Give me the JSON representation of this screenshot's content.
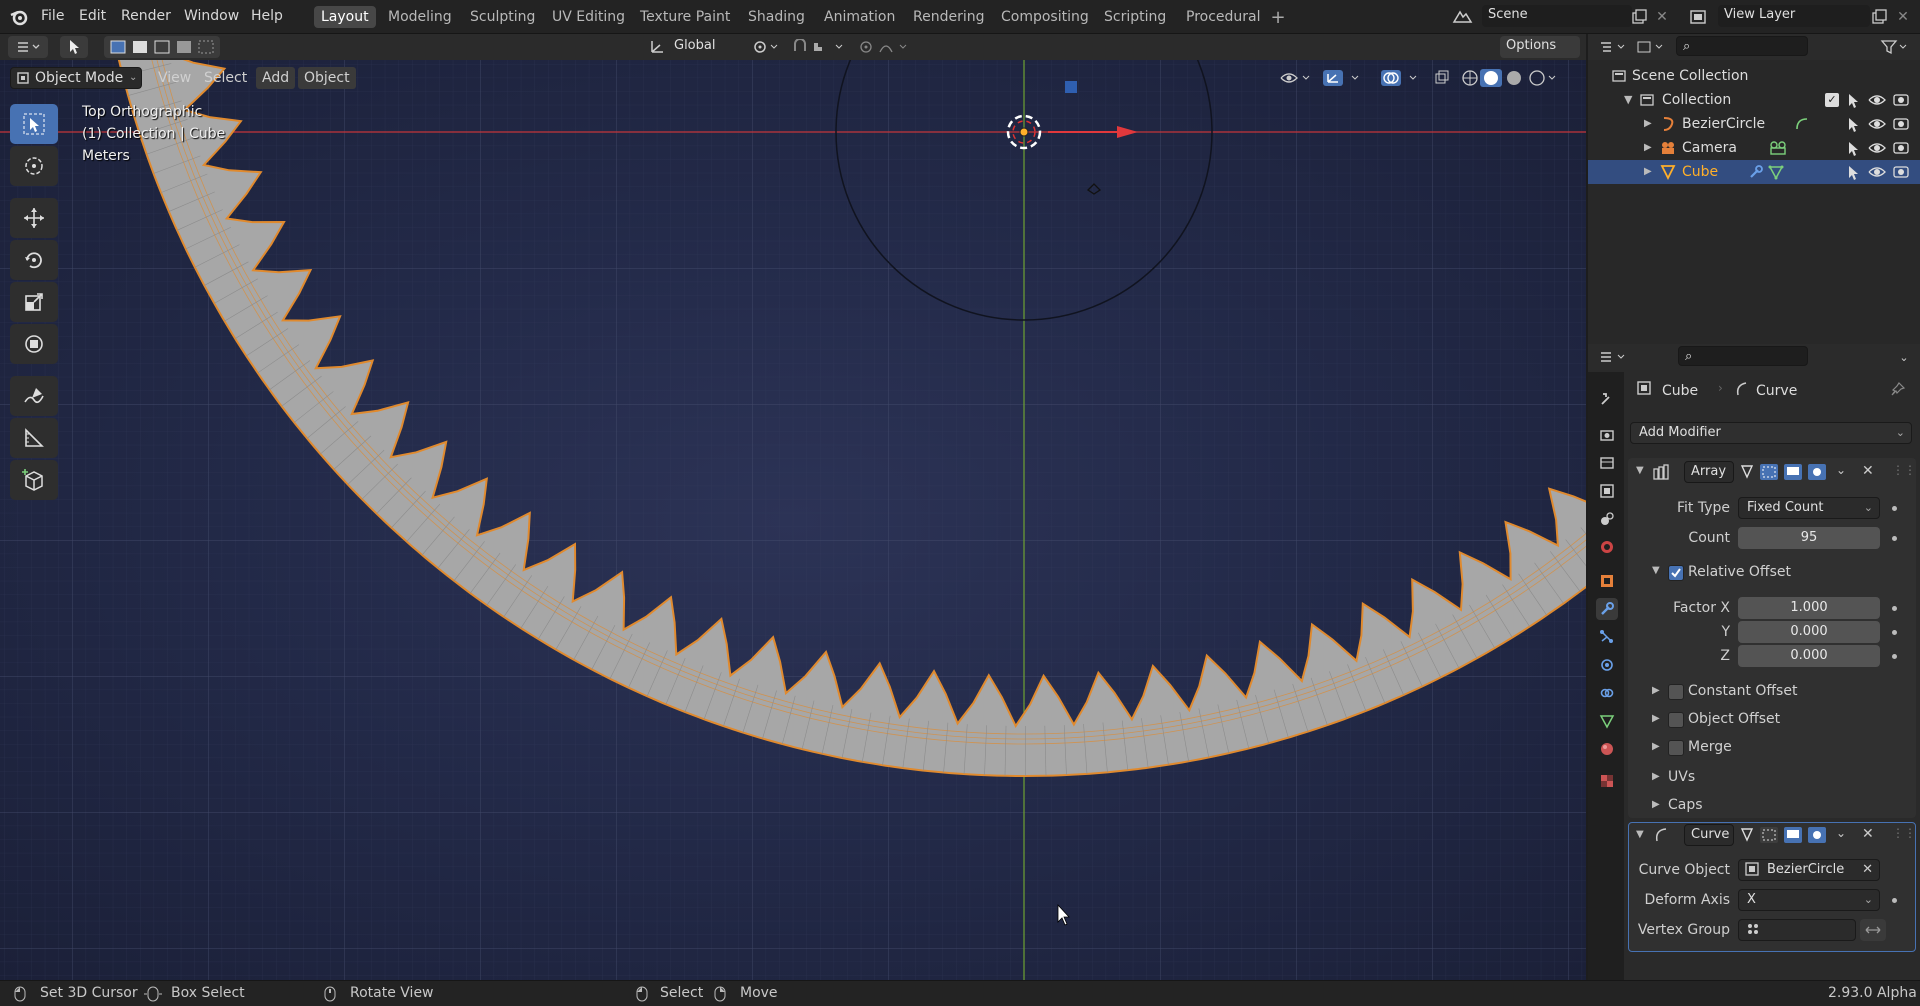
{
  "menu": {
    "file": "File",
    "edit": "Edit",
    "render": "Render",
    "window": "Window",
    "help": "Help"
  },
  "workspaces": [
    "Layout",
    "Modeling",
    "Sculpting",
    "UV Editing",
    "Texture Paint",
    "Shading",
    "Animation",
    "Rendering",
    "Compositing",
    "Scripting",
    "Procedural"
  ],
  "scene": {
    "name": "Scene",
    "view_layer": "View Layer"
  },
  "header": {
    "transform_orientation": "Global",
    "options": "Options"
  },
  "viewport": {
    "mode": "Object Mode",
    "view": "View",
    "select": "Select",
    "add": "Add",
    "object": "Object",
    "overlay_line1": "Top Orthographic",
    "overlay_line2": "(1) Collection | Cube",
    "overlay_line3": "Meters",
    "colors": {
      "x_axis": "#d7383c",
      "y_axis": "#7ab13a",
      "mesh_fill": "#a7a7a7",
      "mesh_edge": "#e08a2e"
    }
  },
  "outliner": {
    "root": "Scene Collection",
    "collection": "Collection",
    "items": [
      {
        "label": "BezierCircle"
      },
      {
        "label": "Camera"
      },
      {
        "label": "Cube"
      }
    ]
  },
  "properties": {
    "breadcrumb_object": "Cube",
    "breadcrumb_data": "Curve",
    "add_modifier": "Add Modifier",
    "array": {
      "name": "Array",
      "fit_type_label": "Fit Type",
      "fit_type": "Fixed Count",
      "count_label": "Count",
      "count": "95",
      "relative_offset": "Relative Offset",
      "factor_x_label": "Factor X",
      "factor_x": "1.000",
      "y_label": "Y",
      "y": "0.000",
      "z_label": "Z",
      "z": "0.000",
      "constant_offset": "Constant Offset",
      "object_offset": "Object Offset",
      "merge": "Merge",
      "uvs": "UVs",
      "caps": "Caps"
    },
    "curve": {
      "name": "Curve",
      "curve_object_label": "Curve Object",
      "curve_object": "BezierCircle",
      "deform_axis_label": "Deform Axis",
      "deform_axis": "X",
      "vertex_group_label": "Vertex Group"
    }
  },
  "status": {
    "set_cursor": "Set 3D Cursor",
    "box_select": "Box Select",
    "rotate_view": "Rotate View",
    "select": "Select",
    "move": "Move",
    "version": "2.93.0 Alpha"
  }
}
